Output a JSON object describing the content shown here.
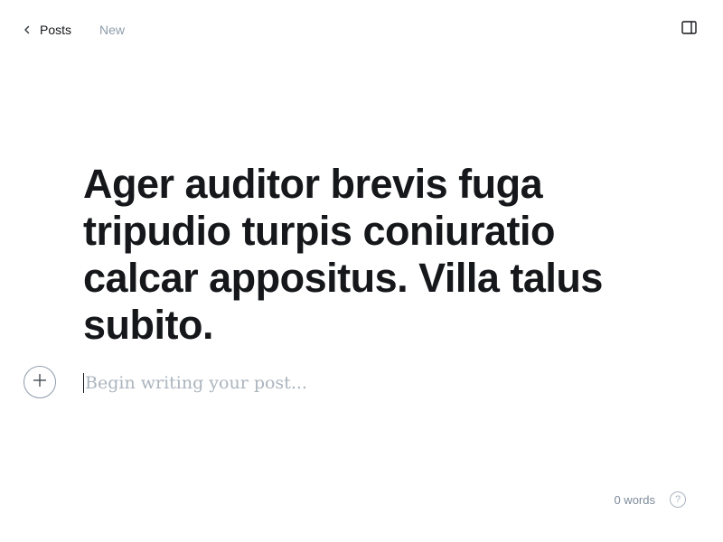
{
  "header": {
    "back_label": "Posts",
    "status": "New"
  },
  "editor": {
    "title": "Ager auditor brevis fuga tripudio turpis coniuratio calcar appositus. Villa talus subito.",
    "body_placeholder": "Begin writing your post..."
  },
  "footer": {
    "word_count": "0 words",
    "help": "?"
  },
  "icons": {
    "back": "chevron-left-icon",
    "sidebar": "sidebar-panel-icon",
    "add_card": "plus-icon",
    "help": "help-circle-icon"
  }
}
